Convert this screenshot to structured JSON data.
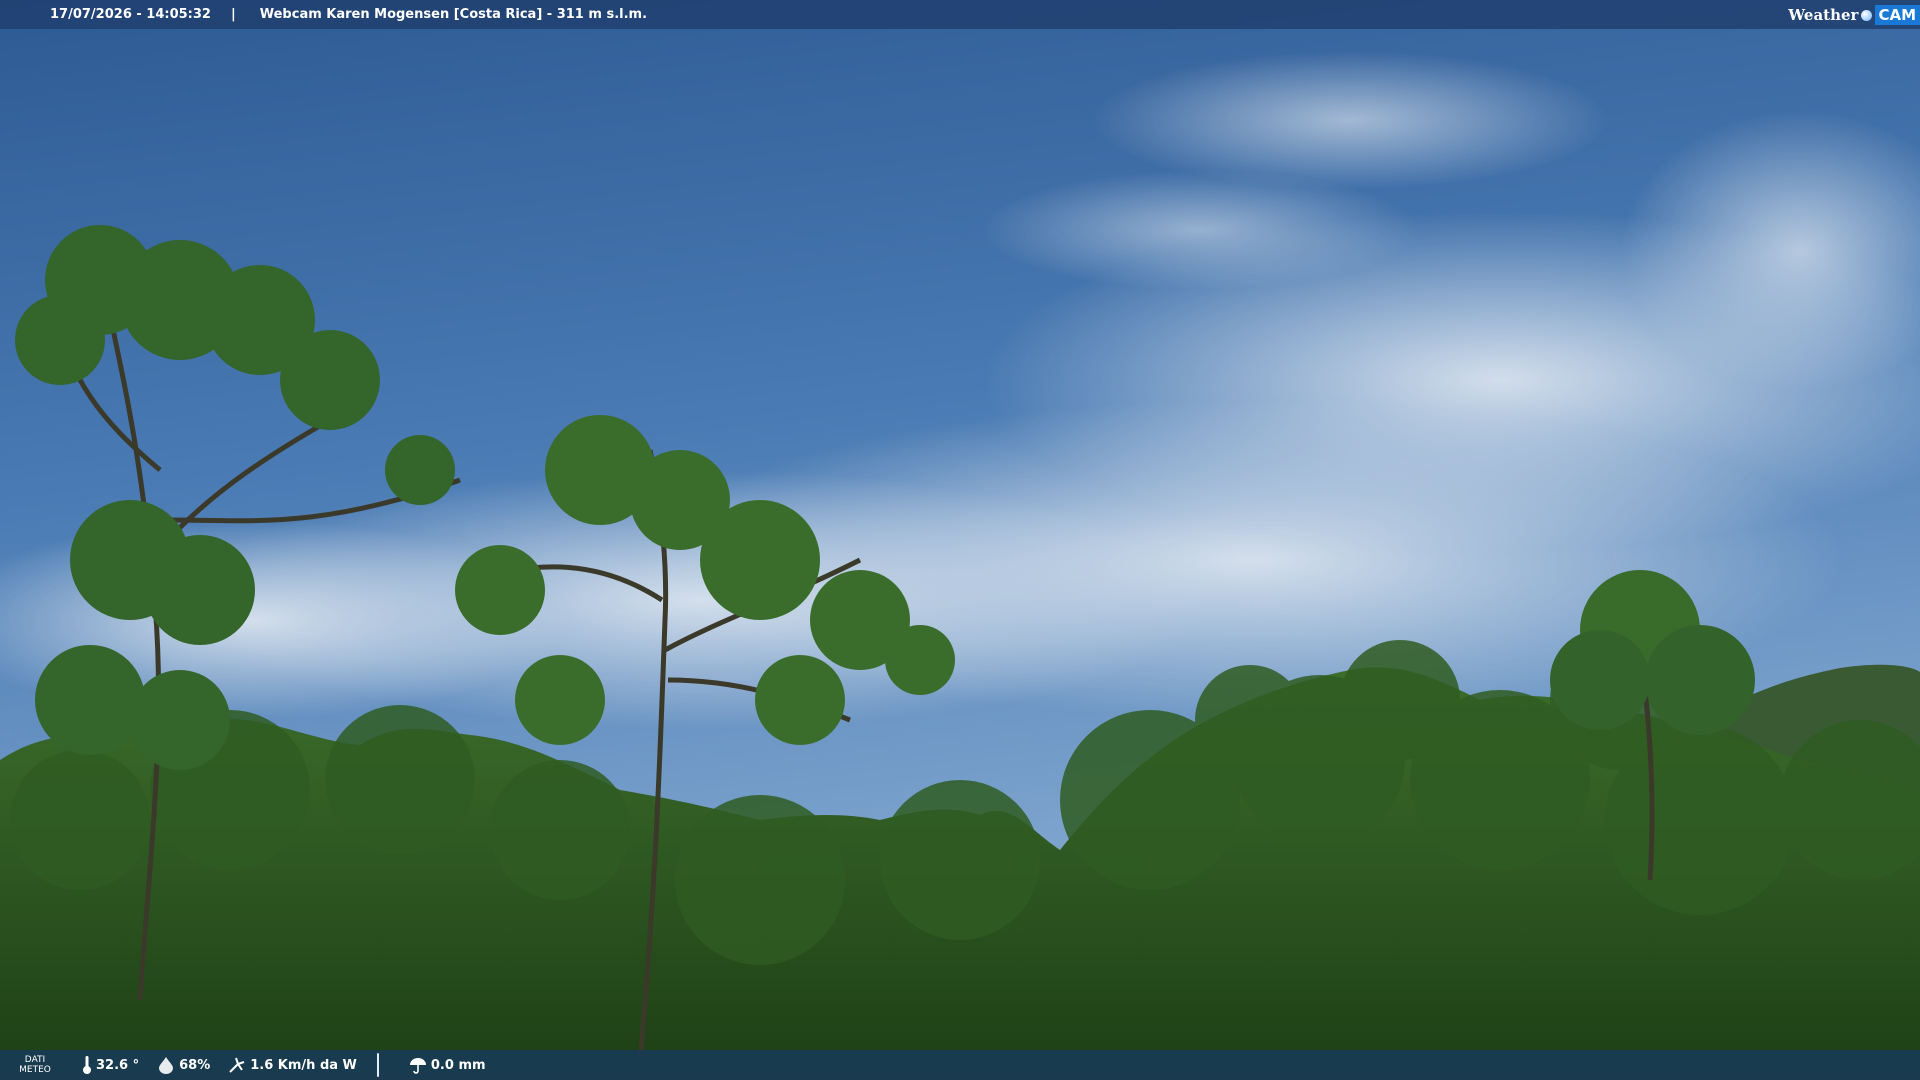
{
  "overlay": {
    "timestamp": "17/07/2026 - 14:05:32",
    "separator": "|",
    "location": "Webcam Karen Mogensen [Costa Rica]  - 311 m s.l.m.",
    "brand_weather": "Weather",
    "brand_cam": "CAM"
  },
  "weather": {
    "label_line1": "DATI",
    "label_line2": "METEO",
    "temperature": "32.6 °",
    "humidity": "68%",
    "wind": "1.6 Km/h da W",
    "rain": "0.0 mm"
  },
  "scene": {
    "sky_color": "#3f6ea6",
    "cloud_color": "#dfe6ee",
    "foliage_color": "#27501d",
    "icons": [
      "thermometer-icon",
      "humidity-drop-icon",
      "wind-icon",
      "rain-icon"
    ]
  }
}
